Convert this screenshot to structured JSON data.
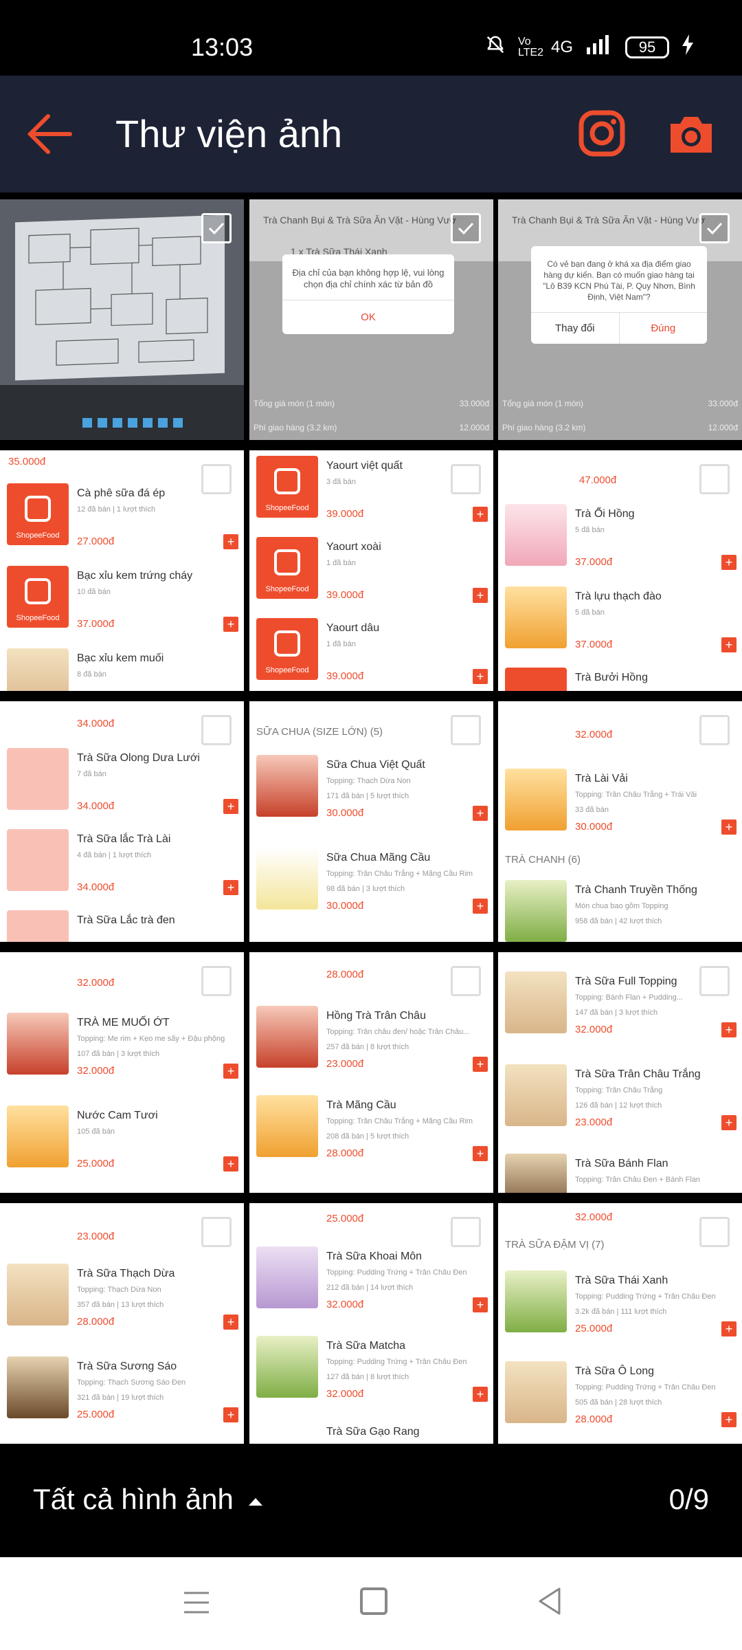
{
  "status": {
    "time": "13:03",
    "network": "4G",
    "volte": "Vo LTE2",
    "battery": "95"
  },
  "appbar": {
    "title": "Thư viện ảnh"
  },
  "cells": {
    "order2": {
      "shop": "Trà Chanh Bụi & Trà Sữa Ăn Vặt - Hùng Vươ",
      "item": "1 x Trà Sữa Thái Xanh",
      "dialog": "Địa chỉ của bạn không hợp lệ, vui lòng chọn địa chỉ chính xác từ bản đồ",
      "ok": "OK",
      "total_label": "Tổng giá món (1 món)",
      "total": "33.000đ",
      "ship_label": "Phí giao hàng (3.2 km)",
      "ship": "12.000đ"
    },
    "order3": {
      "shop": "Trà Chanh Bụi & Trà Sữa Ăn Vặt - Hùng Vươ",
      "dialog": "Có vẻ bạn đang ở khá xa địa điểm giao hàng dự kiến. Bạn có muốn giao hàng tại \"Lô B39 KCN Phú Tài, P. Quy Nhơn, Bình Định, Việt Nam\"?",
      "change": "Thay đổi",
      "confirm": "Đúng",
      "total_label": "Tổng giá món (1 món)",
      "total": "33.000đ",
      "ship_label": "Phí giao hàng (3.2 km)",
      "ship": "12.000đ"
    },
    "c4": {
      "top": "35.000đ",
      "items": [
        {
          "name": "Cà phê sữa đá ép",
          "meta": "12 đã bán | 1 lượt thích",
          "price": "27.000đ"
        },
        {
          "name": "Bạc xỉu kem trứng cháy",
          "meta": "10 đã bán",
          "price": "37.000đ"
        },
        {
          "name": "Bạc xỉu kem muối",
          "meta": "8 đã bán",
          "price": ""
        }
      ]
    },
    "c5": {
      "items": [
        {
          "name": "Yaourt việt quất",
          "meta": "3 đã bán",
          "price": "39.000đ"
        },
        {
          "name": "Yaourt xoài",
          "meta": "1 đã bán",
          "price": "39.000đ"
        },
        {
          "name": "Yaourt dâu",
          "meta": "1 đã bán",
          "price": "39.000đ"
        }
      ]
    },
    "c6": {
      "top": "47.000đ",
      "items": [
        {
          "name": "Trà Ổi Hồng",
          "meta": "5 đã bán",
          "price": "37.000đ"
        },
        {
          "name": "Trà lựu thạch đào",
          "meta": "5 đã bán",
          "price": "37.000đ"
        },
        {
          "name": "Trà Bưởi Hồng",
          "meta": "",
          "price": ""
        }
      ]
    },
    "c7": {
      "top": "34.000đ",
      "items": [
        {
          "name": "Trà Sữa Olong Dưa Lưới",
          "meta": "7 đã bán",
          "price": "34.000đ"
        },
        {
          "name": "Trà Sữa lắc Trà Lài",
          "meta": "4 đã bán | 1 lượt thích",
          "price": "34.000đ"
        },
        {
          "name": "Trà Sữa Lắc trà đen",
          "meta": "",
          "price": ""
        }
      ]
    },
    "c8": {
      "section": "SỮA CHUA (SIZE LỚN) (5)",
      "items": [
        {
          "name": "Sữa Chua Việt Quất",
          "topping": "Topping: Thạch Dừa Non",
          "meta": "171 đã bán | 5 lượt thích",
          "price": "30.000đ"
        },
        {
          "name": "Sữa Chua Mãng Cầu",
          "topping": "Topping: Trân Châu Trắng + Mãng Cầu Rim",
          "meta": "98 đã bán | 3 lượt thích",
          "price": "30.000đ"
        }
      ]
    },
    "c9": {
      "top": "32.000đ",
      "section": "TRÀ CHANH (6)",
      "items": [
        {
          "name": "Trà Lài Vải",
          "topping": "Topping: Trân Châu Trắng + Trái Vải",
          "meta": "33 đã bán",
          "price": "30.000đ"
        },
        {
          "name": "Trà Chanh Truyền Thống",
          "topping": "Món chua bao gồm Topping",
          "meta": "958 đã bán | 42 lượt thích",
          "price": ""
        }
      ]
    },
    "c10": {
      "top": "32.000đ",
      "items": [
        {
          "name": "TRÀ ME MUỐI ỚT",
          "topping": "Topping: Me rim + Kẹo me sấy + Đậu phộng",
          "meta": "107 đã bán | 3 lượt thích",
          "price": "32.000đ"
        },
        {
          "name": "Nước Cam Tươi",
          "topping": "",
          "meta": "105 đã bán",
          "price": "25.000đ"
        }
      ]
    },
    "c11": {
      "top": "28.000đ",
      "items": [
        {
          "name": "Hồng Trà Trân Châu",
          "topping": "Topping: Trân châu đen/ hoặc Trân Châu...",
          "meta": "257 đã bán | 8 lượt thích",
          "price": "23.000đ"
        },
        {
          "name": "Trà Mãng Cầu",
          "topping": "Topping: Trân Châu Trắng + Mãng Cầu Rim",
          "meta": "208 đã bán | 5 lượt thích",
          "price": "28.000đ"
        }
      ]
    },
    "c12": {
      "items": [
        {
          "name": "Trà Sữa Full Topping",
          "topping": "Topping: Bánh Flan + Pudding...",
          "meta": "147 đã bán | 3 lượt thích",
          "price": "32.000đ"
        },
        {
          "name": "Trà Sữa Trân Châu Trắng",
          "topping": "Topping: Trân Châu Trắng",
          "meta": "126 đã bán | 12 lượt thích",
          "price": "23.000đ"
        },
        {
          "name": "Trà Sữa Bánh Flan",
          "topping": "Topping: Trân Châu Đen + Bánh Flan",
          "meta": "",
          "price": ""
        }
      ]
    },
    "c13": {
      "top": "23.000đ",
      "items": [
        {
          "name": "Trà Sữa Thạch Dừa",
          "topping": "Topping: Thạch Dừa Non",
          "meta": "357 đã bán | 13 lượt thích",
          "price": "28.000đ"
        },
        {
          "name": "Trà Sữa Sương Sáo",
          "topping": "Topping: Thạch Sương Sáo Đen",
          "meta": "321 đã bán | 19 lượt thích",
          "price": "25.000đ"
        }
      ]
    },
    "c14": {
      "top": "25.000đ",
      "items": [
        {
          "name": "Trà Sữa Khoai Môn",
          "topping": "Topping: Pudding Trứng + Trân Châu Đen",
          "meta": "212 đã bán | 14 lượt thích",
          "price": "32.000đ"
        },
        {
          "name": "Trà Sữa Matcha",
          "topping": "Topping: Pudding Trứng + Trân Châu Đen",
          "meta": "127 đã bán | 8 lượt thích",
          "price": "32.000đ"
        },
        {
          "name": "Trà Sữa Gạo Rang",
          "topping": "",
          "meta": "",
          "price": ""
        }
      ]
    },
    "c15": {
      "top": "32.000đ",
      "section": "TRÀ SỮA ĐẬM VỊ (7)",
      "items": [
        {
          "name": "Trà Sữa Thái Xanh",
          "topping": "Topping: Pudding Trứng + Trân Châu Đen",
          "meta": "3.2k đã bán | 111 lượt thích",
          "price": "25.000đ"
        },
        {
          "name": "Trà Sữa Ô Long",
          "topping": "Topping: Pudding Trứng + Trân Châu Đen",
          "meta": "505 đã bán | 28 lượt thích",
          "price": "28.000đ"
        }
      ]
    }
  },
  "shopee_label": "ShopeeFood",
  "bottom": {
    "filter_label": "Tất cả hình ảnh",
    "selected_count": "0/9"
  }
}
